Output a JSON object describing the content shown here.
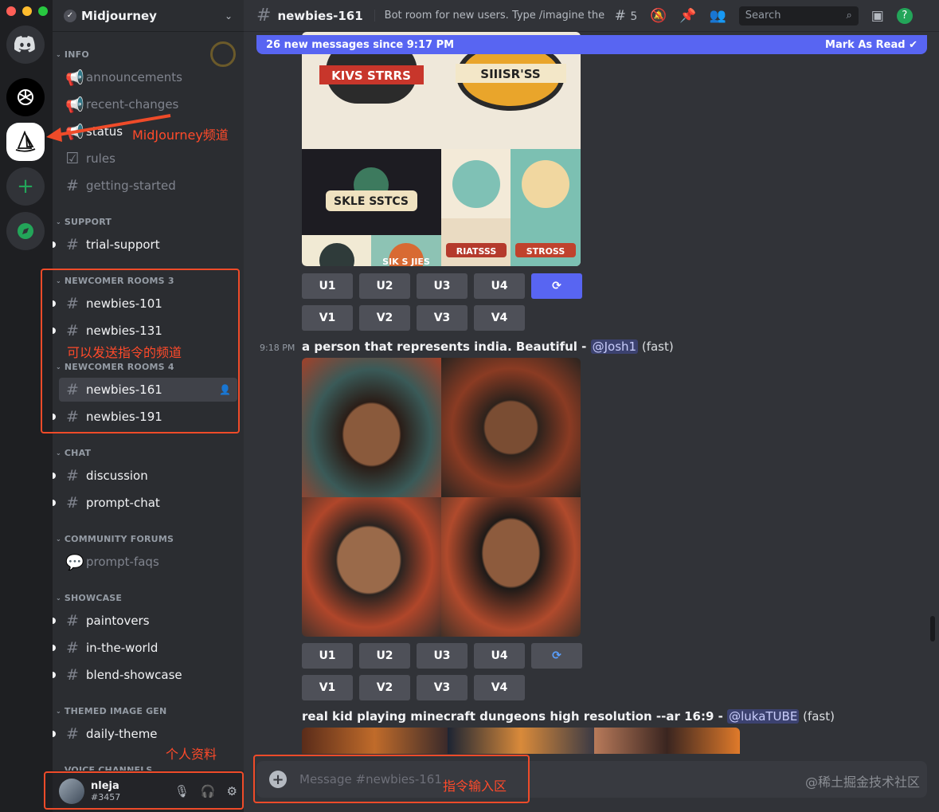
{
  "rail": {
    "servers": [
      "discord-home",
      "chatgpt-server",
      "midjourney-server",
      "add-server",
      "explore-servers"
    ]
  },
  "sidebar": {
    "guild_name": "Midjourney",
    "categories": {
      "info": "INFO",
      "support": "SUPPORT",
      "newcomer3": "NEWCOMER ROOMS 3",
      "newcomer4": "NEWCOMER ROOMS 4",
      "chat": "CHAT",
      "forums": "COMMUNITY FORUMS",
      "showcase": "SHOWCASE",
      "themed": "THEMED IMAGE GEN",
      "voice": "VOICE CHANNELS"
    },
    "channels": {
      "announcements": "announcements",
      "recent_changes": "recent-changes",
      "status": "status",
      "rules": "rules",
      "getting_started": "getting-started",
      "trial_support": "trial-support",
      "newbies_101": "newbies-101",
      "newbies_131": "newbies-131",
      "newbies_161": "newbies-161",
      "newbies_191": "newbies-191",
      "discussion": "discussion",
      "prompt_chat": "prompt-chat",
      "prompt_faqs": "prompt-faqs",
      "paintovers": "paintovers",
      "in_the_world": "in-the-world",
      "blend_showcase": "blend-showcase",
      "daily_theme": "daily-theme"
    }
  },
  "user": {
    "name": "nleja",
    "tag": "#3457"
  },
  "topbar": {
    "channel": "newbies-161",
    "topic": "Bot room for new users. Type /imagine then d...",
    "threads_count": "5",
    "search_placeholder": "Search"
  },
  "new_messages": {
    "text": "26 new messages since 9:17 PM",
    "action": "Mark As Read"
  },
  "messages": {
    "buttons_u": [
      "U1",
      "U2",
      "U3",
      "U4"
    ],
    "buttons_v": [
      "V1",
      "V2",
      "V3",
      "V4"
    ],
    "msg2": {
      "time": "9:18 PM",
      "prompt": "a person that represents india. Beautiful",
      "sep": " - ",
      "mention": "@Josh1",
      "mode": "(fast)"
    },
    "msg3": {
      "prompt": "real kid playing minecraft dungeons high resolution --ar 16:9",
      "sep": " - ",
      "mention": "@lukaTUBE",
      "mode": "(fast)"
    }
  },
  "logo_tiles": [
    "KIVS STRRS",
    "SIIISR'SS",
    "SKLE SSTCS",
    "SIK S JIES",
    "RIATSSS",
    "STROSS"
  ],
  "composer": {
    "placeholder": "Message #newbies-161"
  },
  "watermark": "@稀土掘金技术社区",
  "annotations": {
    "midjourney_channel": "MidJourney频道",
    "command_channels": "可以发送指令的频道",
    "profile": "个人资料",
    "input_area": "指令输入区"
  },
  "colors": {
    "accent": "#5865f2",
    "annotation": "#ef4b29",
    "online": "#23a559"
  }
}
